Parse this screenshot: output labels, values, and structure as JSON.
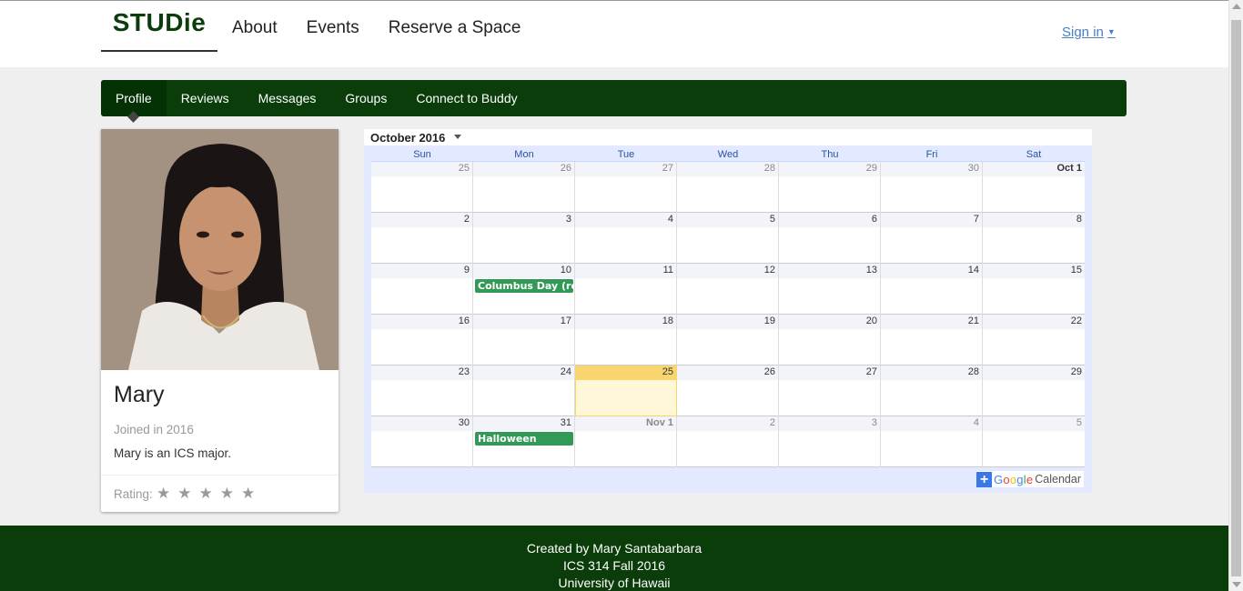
{
  "brand": {
    "name": "STUDie"
  },
  "topnav": {
    "items": [
      "About",
      "Events",
      "Reserve a Space"
    ]
  },
  "signin": {
    "label": "Sign in"
  },
  "subnav": {
    "tabs": [
      "Profile",
      "Reviews",
      "Messages",
      "Groups",
      "Connect to Buddy"
    ],
    "active": "Profile"
  },
  "profile": {
    "name": "Mary",
    "joined": "Joined in 2016",
    "bio": "Mary is an ICS major.",
    "rating_label": "Rating:",
    "rating_stars_filled": 0,
    "rating_stars_total": 5
  },
  "calendar": {
    "month_title": "October 2016",
    "days_of_week": [
      "Sun",
      "Mon",
      "Tue",
      "Wed",
      "Thu",
      "Fri",
      "Sat"
    ],
    "weeks": [
      [
        "25",
        "26",
        "27",
        "28",
        "29",
        "30",
        "Oct 1"
      ],
      [
        "2",
        "3",
        "4",
        "5",
        "6",
        "7",
        "8"
      ],
      [
        "9",
        "10",
        "11",
        "12",
        "13",
        "14",
        "15"
      ],
      [
        "16",
        "17",
        "18",
        "19",
        "20",
        "21",
        "22"
      ],
      [
        "23",
        "24",
        "25",
        "26",
        "27",
        "28",
        "29"
      ],
      [
        "30",
        "31",
        "Nov 1",
        "2",
        "3",
        "4",
        "5"
      ]
    ],
    "events": [
      {
        "week": 2,
        "day": 1,
        "title": "Columbus Day (regional holiday)"
      },
      {
        "week": 5,
        "day": 1,
        "title": "Halloween"
      }
    ],
    "today": {
      "week": 4,
      "day": 2
    },
    "google_link": {
      "plus": "+",
      "google": "Google",
      "calendar": "Calendar"
    }
  },
  "footer": {
    "line1": "Created by Mary Santabarbara",
    "line2": "ICS 314 Fall 2016",
    "line3": "University of Hawaii"
  },
  "colors": {
    "brand_green": "#0b3d0b",
    "event_green": "#339957",
    "today_yellow": "#f8d56f",
    "link_blue": "#4a7fc1"
  }
}
